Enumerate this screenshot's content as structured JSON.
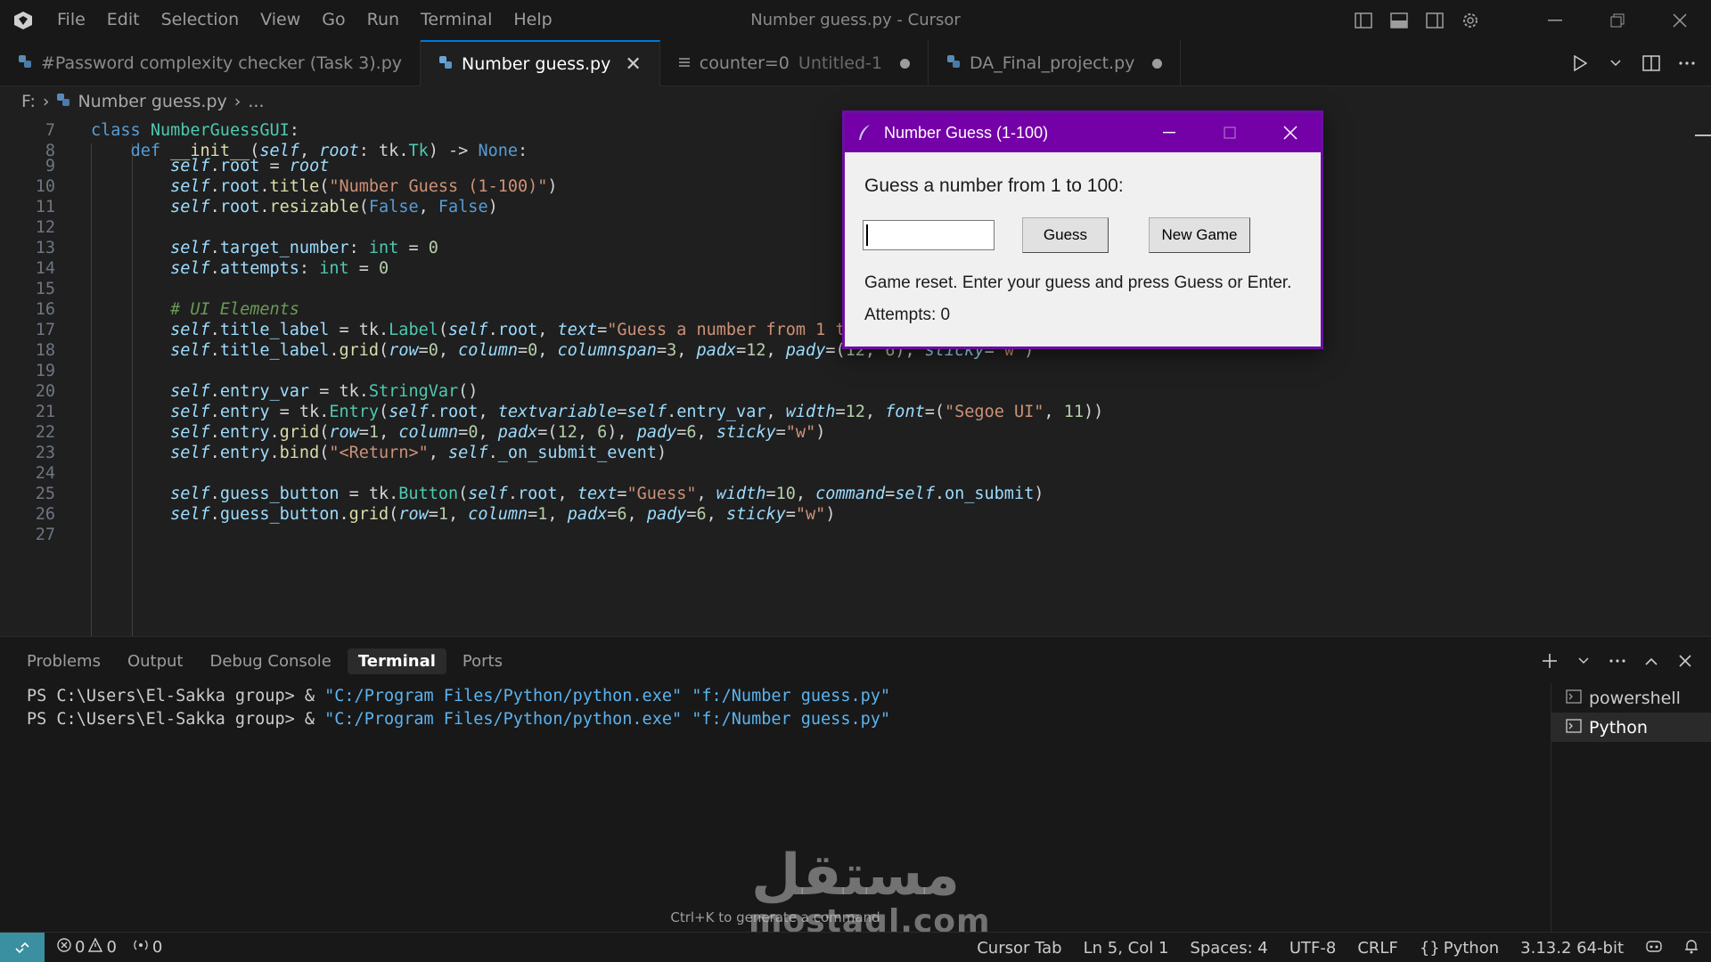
{
  "titlebar": {
    "menu": [
      "File",
      "Edit",
      "Selection",
      "View",
      "Go",
      "Run",
      "Terminal",
      "Help"
    ],
    "window_title": "Number guess.py - Cursor"
  },
  "tabs": [
    {
      "label": "#Password complexity checker (Task 3).py",
      "sub": "",
      "active": false,
      "icon": "python-icon"
    },
    {
      "label": "Number guess.py",
      "sub": "",
      "active": true,
      "icon": "python-icon"
    },
    {
      "label": "counter=0",
      "sub": "Untitled-1",
      "active": false,
      "icon": "list-icon"
    },
    {
      "label": "DA_Final_project.py",
      "sub": "",
      "active": false,
      "icon": "python-icon"
    }
  ],
  "breadcrumb": {
    "drive": "F:",
    "file": "Number guess.py",
    "more": "..."
  },
  "editor": {
    "line_numbers": [
      "7",
      "8",
      "9",
      "10",
      "11",
      "12",
      "13",
      "14",
      "15",
      "16",
      "17",
      "18",
      "19",
      "20",
      "21",
      "22",
      "23",
      "24",
      "25",
      "26",
      "27"
    ]
  },
  "panel": {
    "tabs": [
      "Problems",
      "Output",
      "Debug Console",
      "Terminal",
      "Ports"
    ],
    "active_tab": "Terminal",
    "terminal_lines": [
      {
        "prompt": "PS C:\\Users\\El-Sakka group> & ",
        "exe": "\"C:/Program Files/Python/python.exe\"",
        "arg": " \"f:/Number guess.py\""
      },
      {
        "prompt": "PS C:\\Users\\El-Sakka group> & ",
        "exe": "\"C:/Program Files/Python/python.exe\"",
        "arg": " \"f:/Number guess.py\""
      }
    ],
    "terminals": [
      "powershell",
      "Python"
    ],
    "hint": "Ctrl+K to generate a command"
  },
  "watermark": {
    "arabic": "مستقل",
    "latin": "mostaql.com"
  },
  "statusbar": {
    "errors": "0",
    "warnings": "0",
    "ports": "0",
    "cursor_tab": "Cursor Tab",
    "position": "Ln 5, Col 1",
    "spaces": "Spaces: 4",
    "encoding": "UTF-8",
    "eol": "CRLF",
    "language": "Python",
    "interpreter": "3.13.2 64-bit"
  },
  "tk_dialog": {
    "title": "Number Guess (1-100)",
    "prompt": "Guess a number from 1 to 100:",
    "entry_value": "",
    "guess_button": "Guess",
    "new_game_button": "New Game",
    "status": "Game reset. Enter your guess and press Guess or Enter.",
    "attempts": "Attempts: 0"
  },
  "colors": {
    "accent": "#0078d4",
    "tk_titlebar": "#7400a8",
    "remote": "#3a8fa0"
  }
}
